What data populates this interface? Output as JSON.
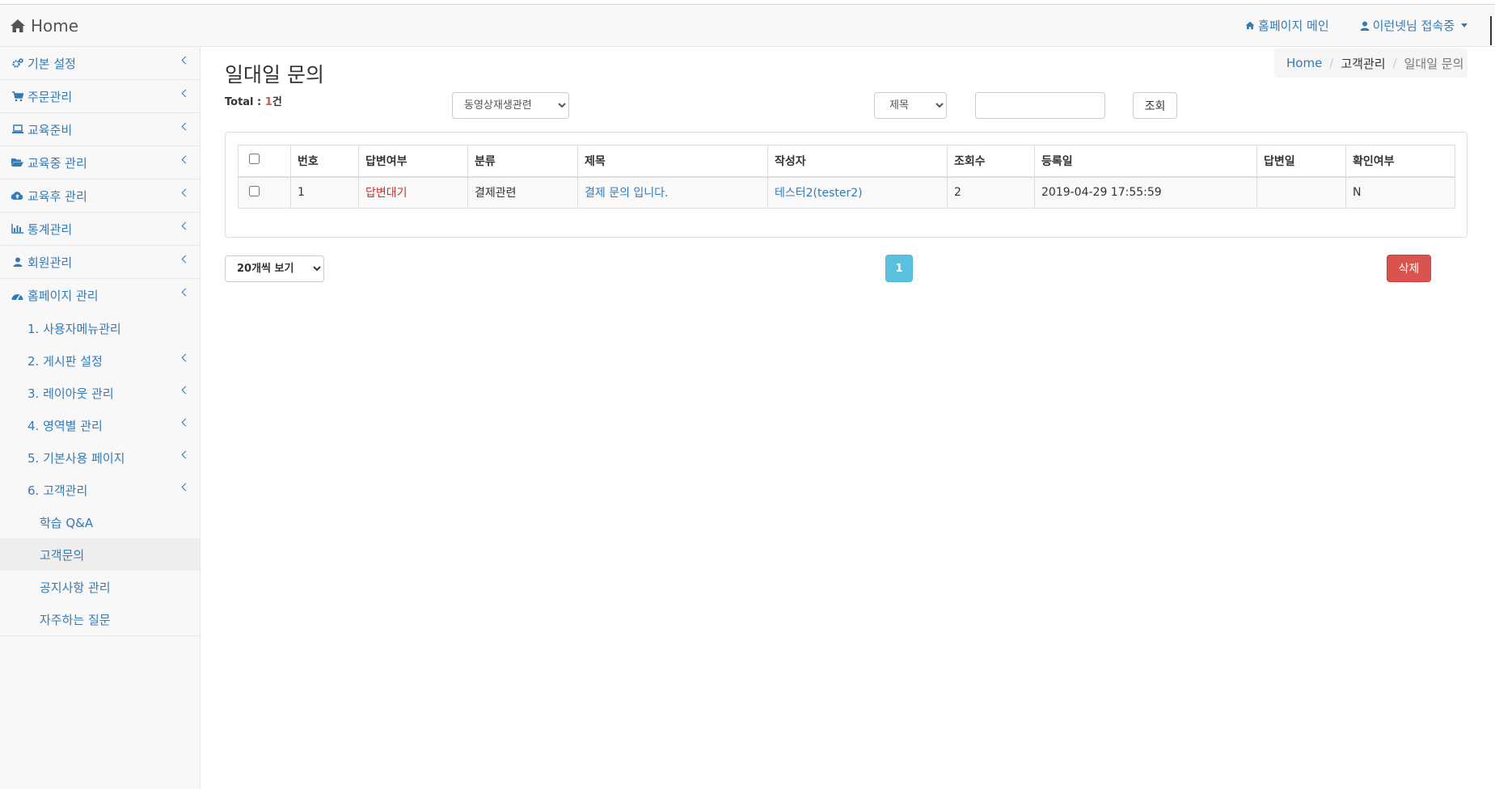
{
  "navbar": {
    "brand": "Home",
    "homepage_link": "홈페이지 메인",
    "user_status": "이런넷님 접속중"
  },
  "sidebar": {
    "items": [
      {
        "label": "기본 설정",
        "icon": "gears-icon"
      },
      {
        "label": "주문관리",
        "icon": "cart-icon"
      },
      {
        "label": "교육준비",
        "icon": "laptop-icon"
      },
      {
        "label": "교육중 관리",
        "icon": "folder-open-icon"
      },
      {
        "label": "교육후 관리",
        "icon": "cloud-upload-icon"
      },
      {
        "label": "통계관리",
        "icon": "bar-chart-icon"
      },
      {
        "label": "회원관리",
        "icon": "user-icon"
      },
      {
        "label": "홈페이지 관리",
        "icon": "dashboard-icon"
      }
    ],
    "sub_items": [
      {
        "label": "1. 사용자메뉴관리"
      },
      {
        "label": "2. 게시판 설정"
      },
      {
        "label": "3. 레이아웃 관리"
      },
      {
        "label": "4. 영역별 관리"
      },
      {
        "label": "5. 기본사용 페이지"
      },
      {
        "label": "6. 고객관리"
      }
    ],
    "sub2_items": [
      {
        "label": "학습 Q&A"
      },
      {
        "label": "고객문의"
      },
      {
        "label": "공지사항 관리"
      },
      {
        "label": "자주하는 질문"
      }
    ]
  },
  "page": {
    "title": "일대일 문의",
    "breadcrumb": [
      "Home",
      "고객관리",
      "일대일 문의"
    ],
    "total_label": "Total : ",
    "total_count": "1",
    "total_unit": "건"
  },
  "filters": {
    "category_selected": "동영상재생관련",
    "field_selected": "제목",
    "search_value": "",
    "search_button": "조회"
  },
  "table": {
    "headers": [
      "번호",
      "답변여부",
      "분류",
      "제목",
      "작성자",
      "조회수",
      "등록일",
      "답변일",
      "확인여부"
    ],
    "rows": [
      {
        "no": "1",
        "status": "답변대기",
        "category": "결제관련",
        "title": "결제 문의 입니다.",
        "author": "테스터2(tester2)",
        "views": "2",
        "created": "2019-04-29 17:55:59",
        "answered": "",
        "confirmed": "N"
      }
    ]
  },
  "footer": {
    "page_size_selected": "20개씩 보기",
    "current_page": "1",
    "delete_button": "삭제"
  },
  "colors": {
    "link": "#337ab7",
    "danger": "#d9534f",
    "info": "#5bc0de",
    "status_pending": "#c9302c"
  }
}
